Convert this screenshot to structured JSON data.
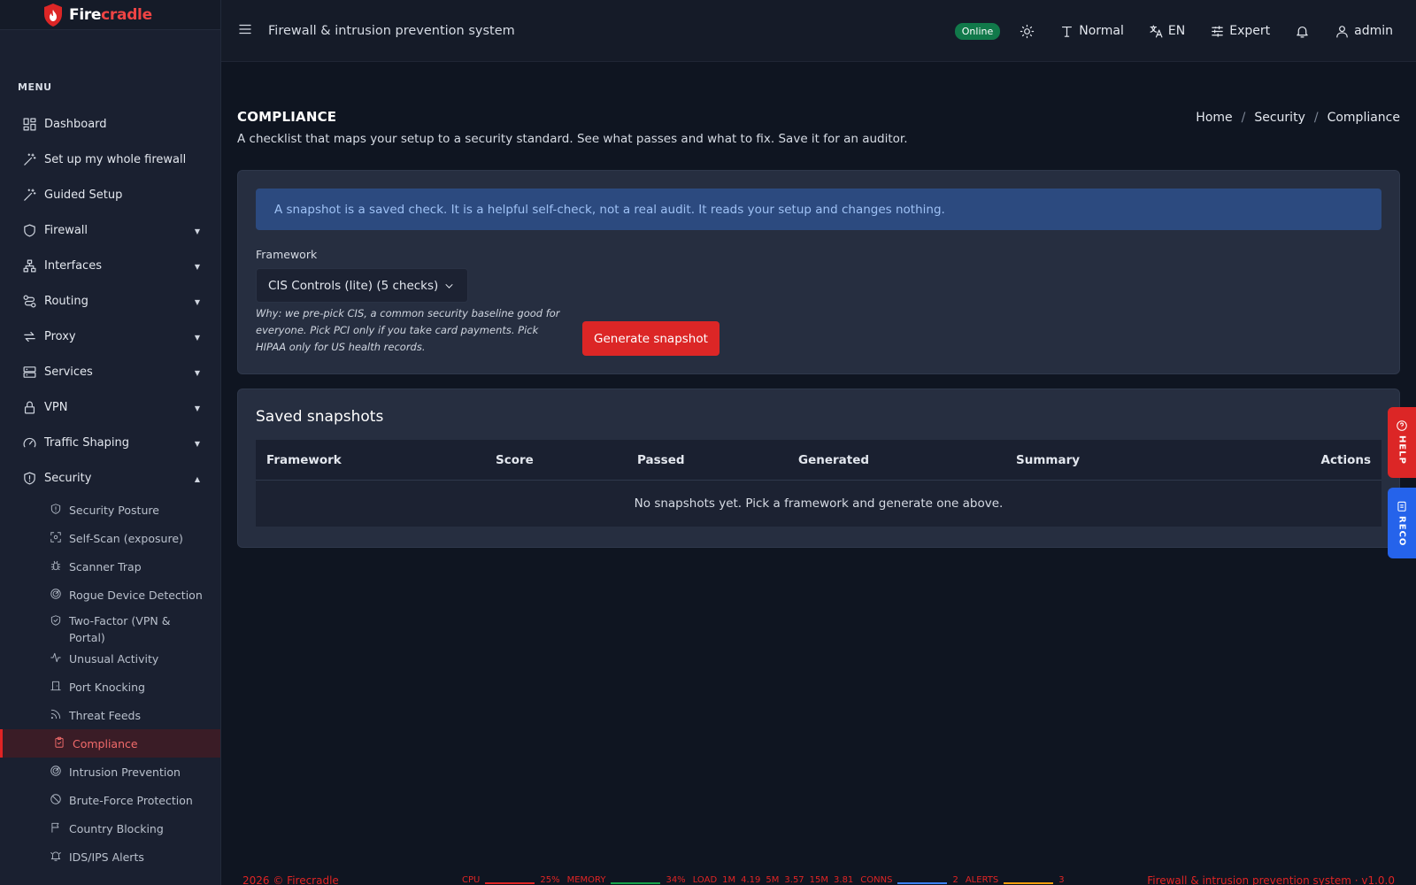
{
  "brand": {
    "name_part1": "Fire",
    "name_part2": "cradle"
  },
  "sidebar": {
    "menu_title": "MENU",
    "items": [
      {
        "label": "Dashboard",
        "icon": "dashboard-icon"
      },
      {
        "label": "Set up my whole firewall",
        "icon": "wand-icon"
      },
      {
        "label": "Guided Setup",
        "icon": "wand-icon"
      },
      {
        "label": "Firewall",
        "icon": "shield-icon"
      },
      {
        "label": "Interfaces",
        "icon": "network-icon"
      },
      {
        "label": "Routing",
        "icon": "route-icon"
      },
      {
        "label": "Proxy",
        "icon": "arrows-icon"
      },
      {
        "label": "Services",
        "icon": "server-icon"
      },
      {
        "label": "VPN",
        "icon": "lock-icon"
      },
      {
        "label": "Traffic Shaping",
        "icon": "gauge-icon"
      },
      {
        "label": "Security",
        "icon": "shield-alert-icon"
      }
    ],
    "security_sub": [
      {
        "label": "Security Posture"
      },
      {
        "label": "Self-Scan (exposure)"
      },
      {
        "label": "Scanner Trap"
      },
      {
        "label": "Rogue Device Detection"
      },
      {
        "label": "Two-Factor (VPN & Portal)"
      },
      {
        "label": "Unusual Activity"
      },
      {
        "label": "Port Knocking"
      },
      {
        "label": "Threat Feeds"
      },
      {
        "label": "Compliance"
      },
      {
        "label": "Intrusion Prevention"
      },
      {
        "label": "Brute-Force Protection"
      },
      {
        "label": "Country Blocking"
      },
      {
        "label": "IDS/IPS Alerts"
      }
    ]
  },
  "header": {
    "title": "Firewall & intrusion prevention system",
    "status": "Online",
    "text_size": "Normal",
    "language": "EN",
    "mode": "Expert",
    "user": "admin"
  },
  "page": {
    "title": "COMPLIANCE",
    "subtitle": "A checklist that maps your setup to a security standard. See what passes and what to fix. Save it for an auditor.",
    "breadcrumbs": [
      "Home",
      "Security",
      "Compliance"
    ]
  },
  "snapshot_card": {
    "alert": "A snapshot is a saved check. It is a helpful self-check, not a real audit. It reads your setup and changes nothing.",
    "framework_label": "Framework",
    "framework_selected": "CIS Controls (lite) (5 checks)",
    "why_text": "Why: we pre-pick CIS, a common security baseline good for everyone. Pick PCI only if you take card payments. Pick HIPAA only for US health records.",
    "generate_button": "Generate snapshot"
  },
  "saved_snapshots": {
    "title": "Saved snapshots",
    "columns": [
      "Framework",
      "Score",
      "Passed",
      "Generated",
      "Summary",
      "Actions"
    ],
    "empty_text": "No snapshots yet. Pick a framework and generate one above."
  },
  "side_tabs": {
    "help": "HELP",
    "reco": "RECO"
  },
  "footer": {
    "copyright": "2026 © Firecradle",
    "cpu_label": "CPU",
    "cpu_value": "25%",
    "memory_label": "MEMORY",
    "memory_value": "34%",
    "load_label": "LOAD",
    "load_1m_label": "1M",
    "load_1m": "4.19",
    "load_5m_label": "5M",
    "load_5m": "3.57",
    "load_15m_label": "15M",
    "load_15m": "3.81",
    "conns_label": "CONNS",
    "conns_value": "2",
    "alerts_label": "ALERTS",
    "alerts_value": "3",
    "version_text": "Firewall & intrusion prevention system · v1.0.0"
  },
  "colors": {
    "accent": "#dc2626",
    "online": "#11794a",
    "info_bg": "#2c4a7f",
    "reco": "#2563eb"
  }
}
